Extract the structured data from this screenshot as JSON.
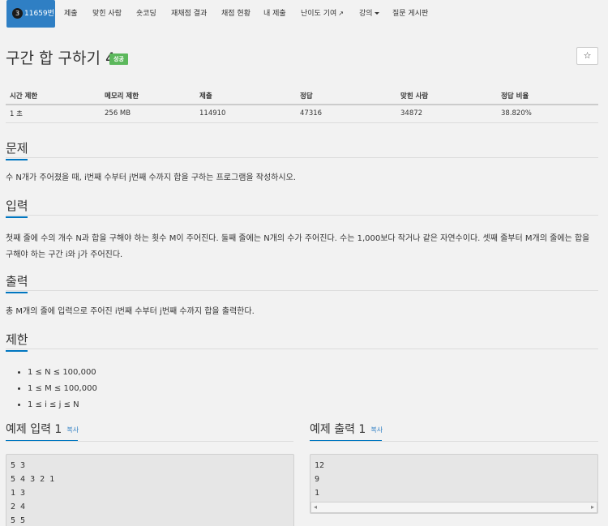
{
  "tabs": [
    {
      "label": "11659번",
      "badge": "3",
      "active": true
    },
    {
      "label": "제출"
    },
    {
      "label": "맞힌 사람"
    },
    {
      "label": "숏코딩"
    },
    {
      "label": "재채점 결과"
    },
    {
      "label": "채점 현황"
    },
    {
      "label": "내 제출"
    },
    {
      "label": "난이도 기여"
    },
    {
      "label": "강의"
    },
    {
      "label": "질문 게시판"
    }
  ],
  "problem": {
    "title": "구간 합 구하기 4",
    "status": "성공",
    "star": "☆"
  },
  "info_table": {
    "headers": [
      "시간 제한",
      "메모리 제한",
      "제출",
      "정답",
      "맞힌 사람",
      "정답 비율"
    ],
    "values": [
      "1 초",
      "256 MB",
      "114910",
      "47316",
      "34872",
      "38.820%"
    ]
  },
  "sections": {
    "problem_head": "문제",
    "problem_text": "수 N개가 주어졌을 때, i번째 수부터 j번째 수까지 합을 구하는 프로그램을 작성하시오.",
    "input_head": "입력",
    "input_text": "첫째 줄에 수의 개수 N과 합을 구해야 하는 횟수 M이 주어진다. 둘째 줄에는 N개의 수가 주어진다. 수는 1,000보다 작거나 같은 자연수이다. 셋째 줄부터 M개의 줄에는 합을 구해야 하는 구간 i와 j가 주어진다.",
    "output_head": "출력",
    "output_text": "총 M개의 줄에 입력으로 주어진 i번째 수부터 j번째 수까지 합을 출력한다.",
    "limit_head": "제한",
    "limits": [
      "1 ≤ N ≤ 100,000",
      "1 ≤ M ≤ 100,000",
      "1 ≤ i ≤ j ≤ N"
    ]
  },
  "examples": {
    "input_title": "예제 입력 1",
    "output_title": "예제 출력 1",
    "copy_label": "복사",
    "input_text": "5 3\n5 4 3 2 1\n1 3\n2 4\n5 5",
    "output_text": "12\n9\n1"
  },
  "colors": {
    "tab_active": "#2f7fc4",
    "status_success": "#5cb85c",
    "section_underline": "#0076c0"
  }
}
